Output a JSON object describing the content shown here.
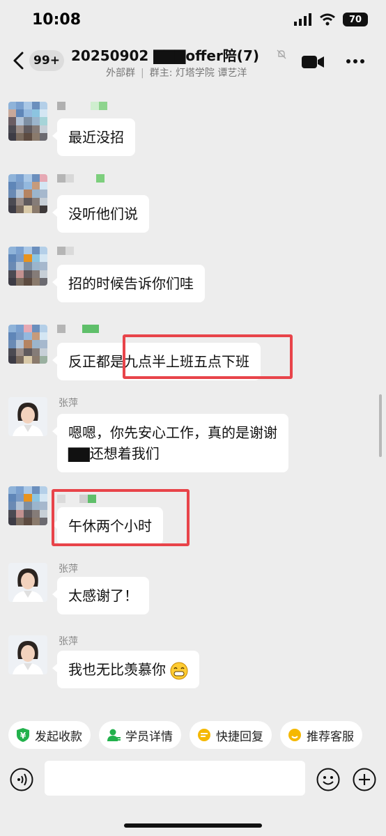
{
  "status": {
    "time": "10:08",
    "battery": "70"
  },
  "header": {
    "back_badge": "99+",
    "title": "20250902 ▇▇▇offer陪(7)",
    "subtitle_left": "外部群",
    "subtitle_right": "群主: 灯塔学院 谭艺洋"
  },
  "messages": [
    {
      "sender": "",
      "text": "最近没招"
    },
    {
      "sender": "",
      "text": "没听他们说"
    },
    {
      "sender": "",
      "text": "招的时候告诉你们哇"
    },
    {
      "sender": "",
      "text": "反正都是九点半上班五点下班"
    },
    {
      "sender": "张萍",
      "text_line1": "嗯嗯，你先安心工作，真的是谢谢",
      "text_line2": "▇▇还想着我们"
    },
    {
      "sender": "",
      "text": "午休两个小时"
    },
    {
      "sender": "张萍",
      "text": "太感谢了！"
    },
    {
      "sender": "张萍",
      "text": "我也无比羡慕你"
    }
  ],
  "toolbar": {
    "chips": [
      {
        "label": "发起收款",
        "icon": "yen-shield-icon"
      },
      {
        "label": "学员详情",
        "icon": "person-icon"
      },
      {
        "label": "快捷回复",
        "icon": "quick-reply-icon"
      },
      {
        "label": "推荐客服",
        "icon": "service-icon"
      }
    ]
  },
  "input": {
    "value": ""
  },
  "colors": {
    "highlight": "#e8444a",
    "background": "#ededed",
    "bubble": "#ffffff"
  }
}
